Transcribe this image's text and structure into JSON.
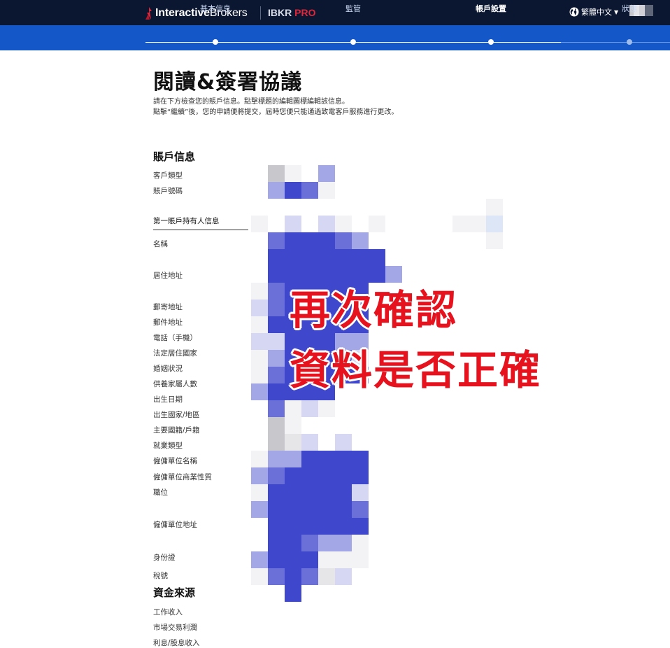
{
  "header": {
    "logo_strong": "Interactive",
    "logo_rest": "Brokers",
    "product_prefix": "IBKR",
    "product_suffix": "PRO",
    "language": "繁體中文"
  },
  "steps": [
    {
      "label": "基本信息"
    },
    {
      "label": "監管"
    },
    {
      "label": "帳戶設置"
    },
    {
      "label": "狀態"
    }
  ],
  "page": {
    "title": "閱讀&簽署協議",
    "intro_1": "請在下方檢查您的賬戶信息。點擊標題的編輯圖標編輯該信息。",
    "intro_2": "點擊“繼續”後，您的申請便將提交，屆時您便只能通過致電客戶服務進行更改。"
  },
  "account_info": {
    "title": "賬戶信息",
    "fields": [
      "客戶類型",
      "賬戶號碼"
    ]
  },
  "holder_info": {
    "title": "第一賬戶持有人信息",
    "fields": [
      "名稱",
      "居住地址",
      "郵寄地址",
      "郵件地址",
      "電話（手機）",
      "法定居住國家",
      "婚姻狀況",
      "供養家屬人數",
      "出生日期",
      "出生國家/地區",
      "主要國籍/戶籍",
      "就業類型",
      "僱傭單位名稱",
      "僱傭單位商業性質",
      "職位",
      "僱傭單位地址",
      "身份證",
      "稅號"
    ]
  },
  "funds_source": {
    "title": "資金來源",
    "fields": [
      "工作收入",
      "市場交易利潤",
      "利息/股息收入"
    ]
  },
  "overlay": {
    "line_1": "再次確認",
    "line_2": "資料是否正確"
  },
  "colors": {
    "header_bg": "#0b1630",
    "stepbar_bg": "#1357c9",
    "brand_red": "#e0283a",
    "overlay_red": "#e6121e",
    "mosaic_blue": "#3f48cc"
  },
  "icons": [
    "logo-mark-icon",
    "globe-icon",
    "chevron-down-icon"
  ]
}
